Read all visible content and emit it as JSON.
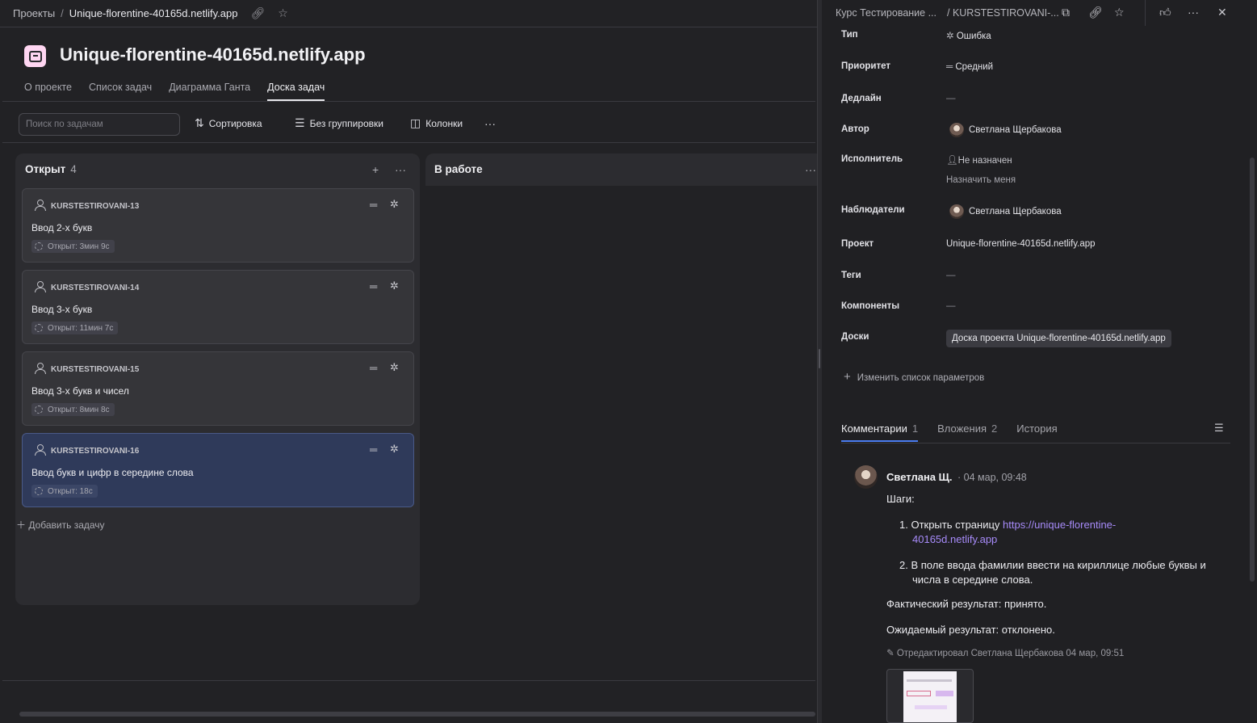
{
  "breadcrumb": {
    "root": "Проекты",
    "separator": "/",
    "current": "Unique-florentine-40165d.netlify.app"
  },
  "project": {
    "title": "Unique-florentine-40165d.netlify.app",
    "tabs": [
      {
        "label": "О проекте",
        "active": false
      },
      {
        "label": "Список задач",
        "active": false
      },
      {
        "label": "Диаграмма Ганта",
        "active": false
      },
      {
        "label": "Доска задач",
        "active": true
      }
    ]
  },
  "toolbar": {
    "search_placeholder": "Поиск по задачам",
    "sort_label": "Сортировка",
    "group_label": "Без группировки",
    "columns_label": "Колонки",
    "more": "···"
  },
  "board": {
    "columns": [
      {
        "title": "Открыт",
        "count": "4",
        "cards": [
          {
            "key": "KURSTESTIROVANI-13",
            "title": "Ввод 2-х букв",
            "status": "Открыт: 3мин 9с",
            "selected": false
          },
          {
            "key": "KURSTESTIROVANI-14",
            "title": "Ввод 3-х букв",
            "status": "Открыт: 11мин 7с",
            "selected": false
          },
          {
            "key": "KURSTESTIROVANI-15",
            "title": "Ввод 3-х букв и чисел",
            "status": "Открыт: 8мин 8с",
            "selected": false
          },
          {
            "key": "KURSTESTIROVANI-16",
            "title": "Ввод букв и цифр в середине слова",
            "status": "Открыт: 18с",
            "selected": true
          }
        ],
        "add_label": "Добавить задачу"
      },
      {
        "title": "В работе",
        "count": "",
        "cards": []
      }
    ]
  },
  "issue_panel": {
    "breadcrumb_queue": "Курс Тестирование ...",
    "breadcrumb_key": "/ KURSTESTIROVANI-...",
    "props": {
      "type": {
        "label": "Тип",
        "value": "Ошибка"
      },
      "priority": {
        "label": "Приоритет",
        "value": "Средний"
      },
      "deadline": {
        "label": "Дедлайн",
        "value": "—"
      },
      "author": {
        "label": "Автор",
        "value": "Светлана Щербакова"
      },
      "assignee": {
        "label": "Исполнитель",
        "value": "Не назначен",
        "action": "Назначить меня"
      },
      "followers": {
        "label": "Наблюдатели",
        "value": "Светлана Щербакова"
      },
      "project": {
        "label": "Проект",
        "value": "Unique-florentine-40165d.netlify.app"
      },
      "tags": {
        "label": "Теги",
        "value": "—"
      },
      "components": {
        "label": "Компоненты",
        "value": "—"
      },
      "boards": {
        "label": "Доски",
        "value": "Доска проекта Unique-florentine-40165d.netlify.app"
      }
    },
    "change_params": "Изменить список параметров",
    "tabs": [
      {
        "label": "Комментарии",
        "count": "1",
        "active": true
      },
      {
        "label": "Вложения",
        "count": "2",
        "active": false
      },
      {
        "label": "История",
        "count": "",
        "active": false
      }
    ],
    "comment": {
      "author": "Светлана Щ.",
      "dot": "·",
      "time": "04 мар, 09:48",
      "steps_title": "Шаги:",
      "step1_text": "1. Открыть страницу ",
      "step1_link_a": "https://unique-florentine-",
      "step1_link_b": "40165d.netlify.app",
      "step2_a": "2. В поле ввода фамилии ввести на кириллице любые буквы и",
      "step2_b": "числа в середине слова.",
      "actual": "Фактический результат: принято.",
      "expected": "Ожидаемый результат: отклонено.",
      "edited": "Отредактировал Светлана Щербакова 04 мар, 09:51"
    }
  },
  "colors": {
    "selected_card": "#2f3a5a",
    "link": "#a78bfa",
    "active_tab_underline": "#4a7cf0"
  }
}
